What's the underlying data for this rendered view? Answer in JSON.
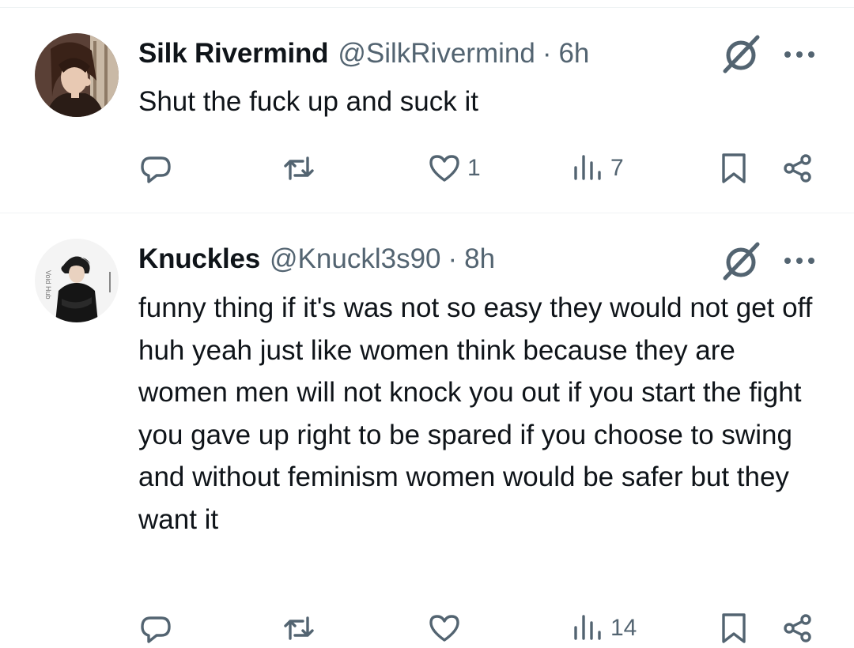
{
  "colors": {
    "text": "#0f1419",
    "secondary": "#536471",
    "divider": "#eff3f4"
  },
  "icons": [
    "grok-icon",
    "more-icon",
    "reply-icon",
    "repost-icon",
    "like-icon",
    "views-icon",
    "bookmark-icon",
    "share-icon"
  ],
  "tweets": [
    {
      "display_name": "Silk Rivermind",
      "handle": "@SilkRivermind",
      "separator": "·",
      "time": "6h",
      "text": "Shut the fuck up and suck it",
      "likes": "1",
      "views": "7"
    },
    {
      "display_name": "Knuckles",
      "handle": "@Knuckl3s90",
      "separator": "·",
      "time": "8h",
      "avatar_text": "Void Hub",
      "text": "funny thing if it's was not so easy they would not get off huh yeah just like women think because they are women men will not knock you out if you start the fight you gave up right to be spared if you choose to swing and without feminism women would be safer but they want it",
      "likes": "",
      "views": "14"
    }
  ]
}
